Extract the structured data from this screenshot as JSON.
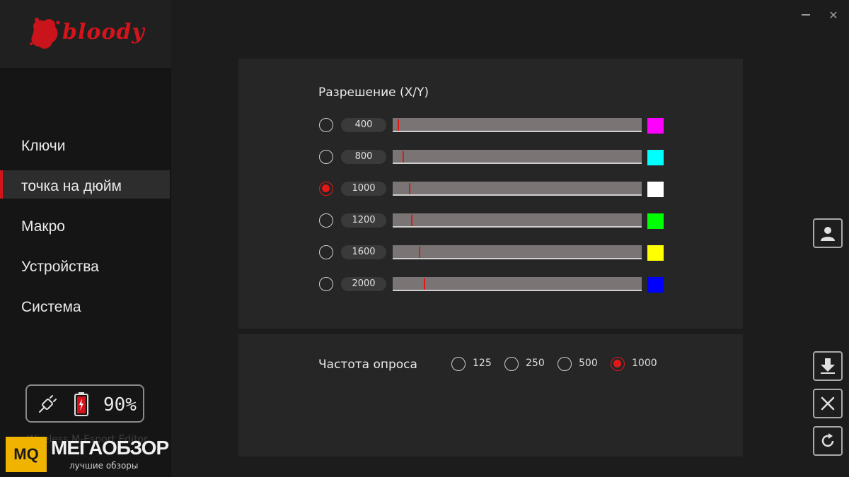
{
  "brand": {
    "logo_text": "bloody"
  },
  "nav": {
    "items": [
      {
        "label": "Ключи"
      },
      {
        "label": "точка на дюйм"
      },
      {
        "label": "Макро"
      },
      {
        "label": "Устройства"
      },
      {
        "label": "Система"
      }
    ],
    "active_index": 1
  },
  "battery": {
    "percent": "90%"
  },
  "app_name": "Wireless M-Esport Editor",
  "watermark": {
    "logo": "MQ",
    "title": "МЕГАОБЗОР",
    "subtitle": "лучшие обзоры"
  },
  "window": {
    "close_glyph": "✕"
  },
  "dpi": {
    "title": "Разрешение (X/Y)",
    "selected_index": 2,
    "levels": [
      {
        "value": "400",
        "color": "#ff00ff",
        "level": 0.02
      },
      {
        "value": "800",
        "color": "#00ffff",
        "level": 0.04
      },
      {
        "value": "1000",
        "color": "#ffffff",
        "level": 0.065
      },
      {
        "value": "1200",
        "color": "#00ff00",
        "level": 0.075
      },
      {
        "value": "1600",
        "color": "#ffff00",
        "level": 0.105
      },
      {
        "value": "2000",
        "color": "#0000ff",
        "level": 0.125
      }
    ]
  },
  "polling": {
    "title": "Частота опроса",
    "selected_index": 3,
    "options": [
      "125",
      "250",
      "500",
      "1000"
    ]
  },
  "accent_color": "#e01818"
}
